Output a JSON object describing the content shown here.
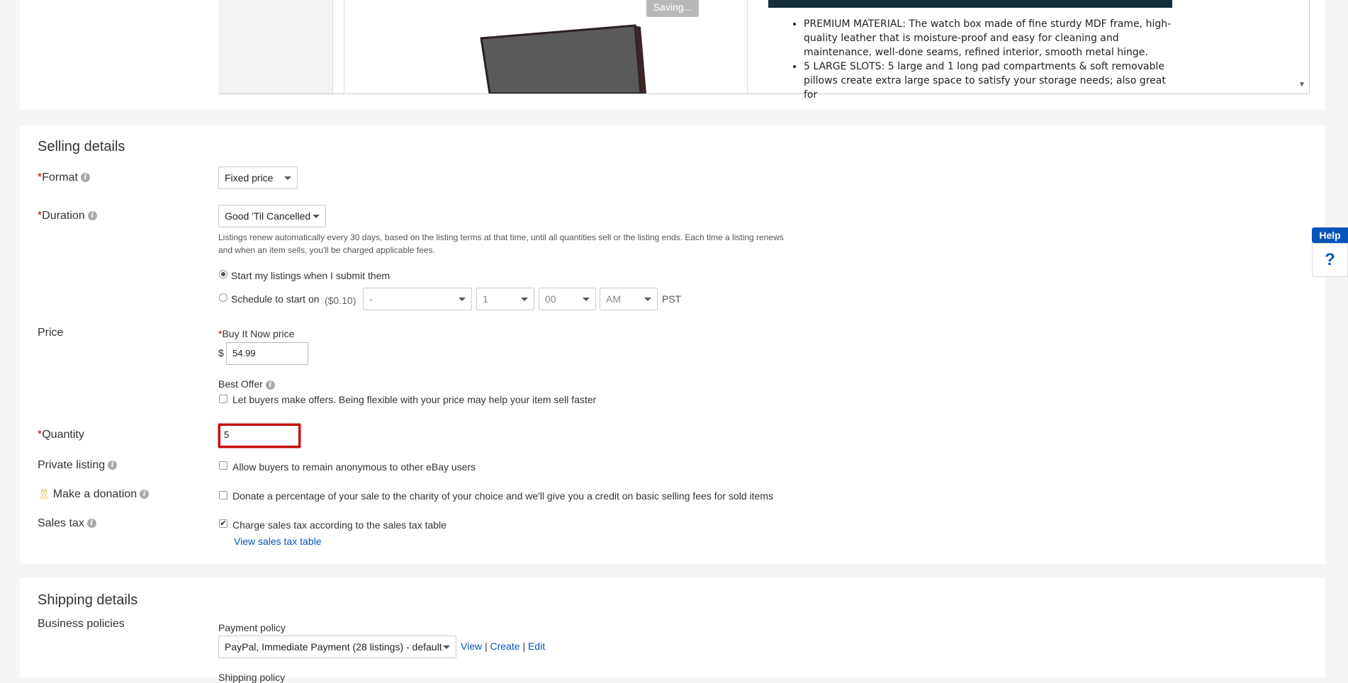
{
  "top": {
    "saving_label": "Saving...",
    "description_items": [
      "PREMIUM MATERIAL: The watch box made of fine sturdy MDF frame, high-quality leather that is moisture-proof and easy for cleaning and maintenance, well-done seams, refined interior, smooth metal hinge.",
      "5 LARGE SLOTS: 5 large and 1 long pad compartments & soft removable pillows create extra large space to satisfy your storage needs; also great for"
    ]
  },
  "selling": {
    "title": "Selling details",
    "format_label": "Format",
    "format_value": "Fixed price",
    "duration_label": "Duration",
    "duration_value": "Good 'Til Cancelled",
    "duration_note": "Listings renew automatically every 30 days, based on the listing terms at that time, until all quantities sell or the listing ends. Each time a listing renews and when an item sells, you'll be charged applicable fees.",
    "start_now_label": "Start my listings when I submit them",
    "schedule_label": "Schedule to start on",
    "schedule_fee": "($0.10)",
    "schedule_date": "-",
    "schedule_hour": "1",
    "schedule_minute": "00",
    "schedule_ampm": "AM",
    "timezone": "PST",
    "price_label": "Price",
    "bin_label": "Buy It Now price",
    "currency": "$",
    "price_value": "54.99",
    "best_offer_label": "Best Offer",
    "best_offer_text": "Let buyers make offers. Being flexible with your price may help your item sell faster",
    "quantity_label": "Quantity",
    "quantity_value": "5",
    "private_label": "Private listing",
    "private_text": "Allow buyers to remain anonymous to other eBay users",
    "donation_label": "Make a donation",
    "donation_text": "Donate a percentage of your sale to the charity of your choice and we'll give you a credit on basic selling fees for sold items",
    "tax_label": "Sales tax",
    "tax_text": "Charge sales tax according to the sales tax table",
    "tax_link": "View sales tax table"
  },
  "shipping": {
    "title": "Shipping details",
    "business_label": "Business policies",
    "payment_label": "Payment policy",
    "payment_value": "PayPal, Immediate Payment (28 listings) - default",
    "view": "View",
    "create": "Create",
    "edit": "Edit",
    "sep": "|",
    "shipping_policy_label": "Shipping policy"
  },
  "help": {
    "label": "Help",
    "icon": "?"
  }
}
